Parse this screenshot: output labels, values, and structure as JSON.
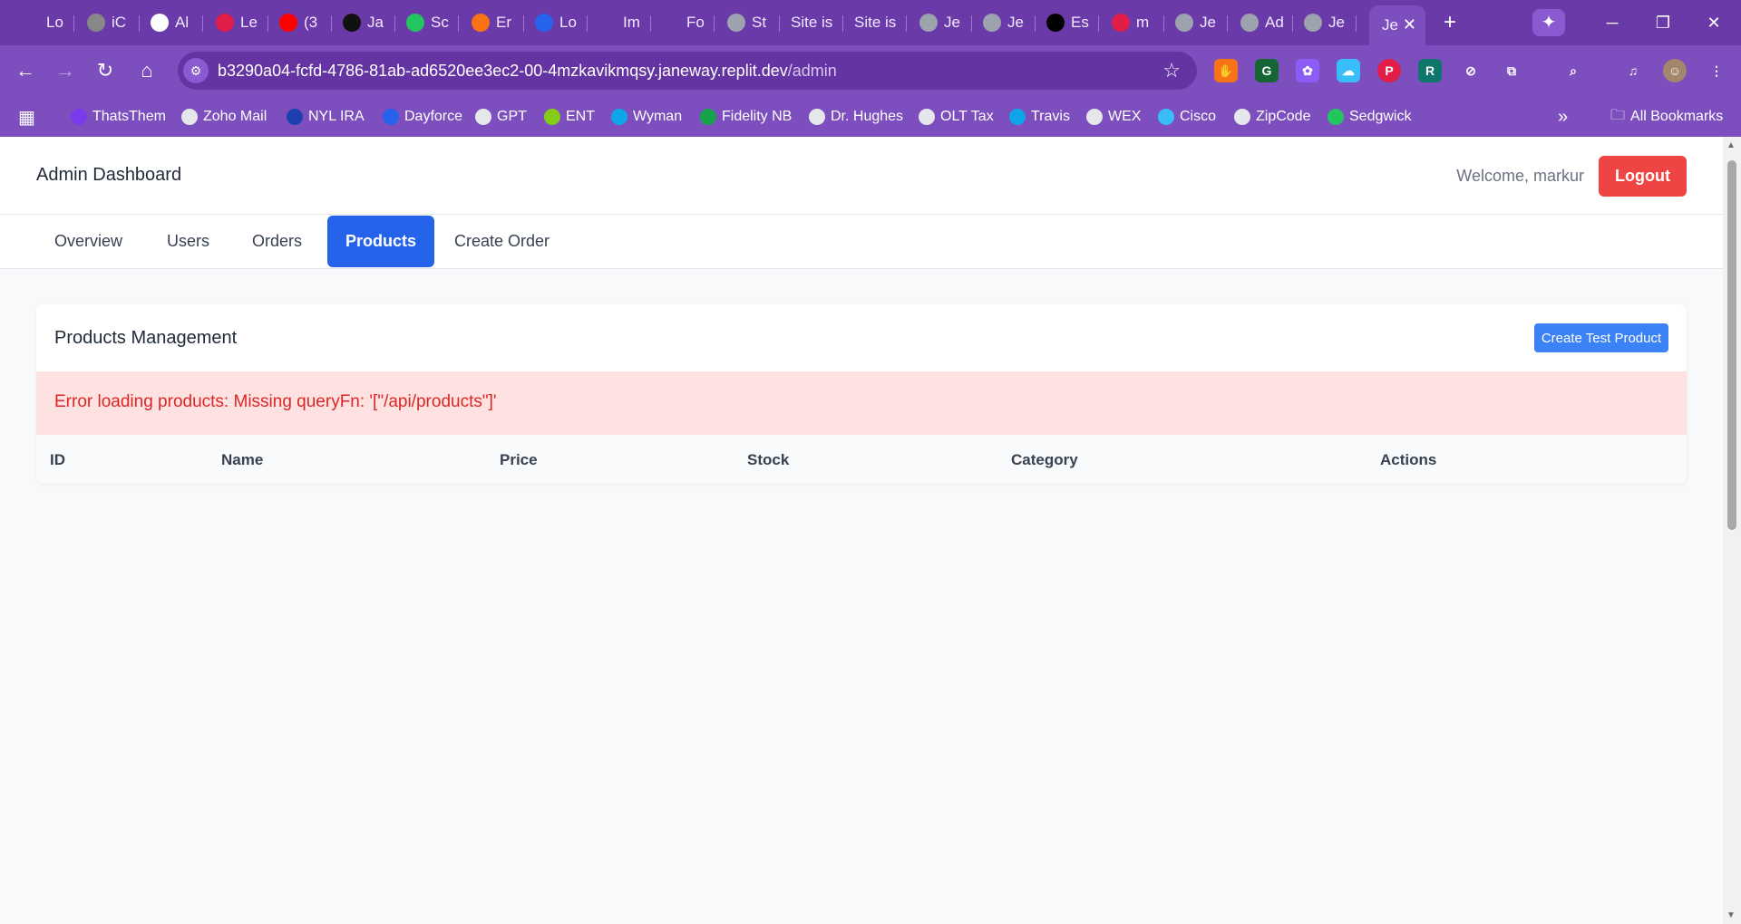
{
  "browser": {
    "tabs": [
      {
        "title": "Lo",
        "icon": "loading-icon",
        "color": "#6a3aa8"
      },
      {
        "title": "iC",
        "icon": "apple-icon",
        "color": "#888888"
      },
      {
        "title": "Al",
        "icon": "ai-icon",
        "color": "#ffffff"
      },
      {
        "title": "Le",
        "icon": "m-logo-icon",
        "color": "#e11d48"
      },
      {
        "title": "(3",
        "icon": "youtube-icon",
        "color": "#ff0000"
      },
      {
        "title": "Ja",
        "icon": "pen-icon",
        "color": "#111111"
      },
      {
        "title": "Sc",
        "icon": "power-icon",
        "color": "#22c55e"
      },
      {
        "title": "Er",
        "icon": "star-badge-icon",
        "color": "#f97316"
      },
      {
        "title": "Lo",
        "icon": "network-icon",
        "color": "#2563eb"
      },
      {
        "title": "Im",
        "icon": "dot-icon",
        "color": "#6a3aa8"
      },
      {
        "title": "Fo",
        "icon": "loading-icon",
        "color": "#6a3aa8"
      },
      {
        "title": "St",
        "icon": "globe-icon",
        "color": "#9ca3af"
      },
      {
        "title": "Site is",
        "icon": "",
        "color": ""
      },
      {
        "title": "Site is",
        "icon": "",
        "color": ""
      },
      {
        "title": "Je",
        "icon": "globe-icon",
        "color": "#9ca3af"
      },
      {
        "title": "Je",
        "icon": "globe-icon",
        "color": "#9ca3af"
      },
      {
        "title": "Es",
        "icon": "mc-icon",
        "color": "#000000"
      },
      {
        "title": "m",
        "icon": "m-logo-icon",
        "color": "#e11d48"
      },
      {
        "title": "Je",
        "icon": "globe-icon",
        "color": "#9ca3af"
      },
      {
        "title": "Ad",
        "icon": "globe-icon",
        "color": "#9ca3af"
      },
      {
        "title": "Je",
        "icon": "globe-icon",
        "color": "#9ca3af"
      }
    ],
    "active_tab": {
      "title": "Je",
      "close_glyph": "✕"
    },
    "new_tab_glyph": "+",
    "url": {
      "host": "b3290a04-fcfd-4786-81ab-ad6520ee3ec2-00-4mzkavikmqsy.janeway.replit.dev",
      "path": "/admin"
    },
    "bookmarks": [
      {
        "label": "ThatsThem",
        "icon": "t-icon",
        "color": "#7c3aed"
      },
      {
        "label": "Zoho Mail",
        "icon": "mail-icon",
        "color": "#e5e7eb"
      },
      {
        "label": "NYL IRA",
        "icon": "nyl-icon",
        "color": "#1e40af"
      },
      {
        "label": "Dayforce",
        "icon": "dayforce-icon",
        "color": "#2563eb"
      },
      {
        "label": "GPT",
        "icon": "openai-icon",
        "color": "#e5e7eb"
      },
      {
        "label": "ENT",
        "icon": "leaf-icon",
        "color": "#84cc16"
      },
      {
        "label": "Wyman",
        "icon": "wyman-icon",
        "color": "#0ea5e9"
      },
      {
        "label": "Fidelity NB",
        "icon": "fidelity-icon",
        "color": "#16a34a"
      },
      {
        "label": "Dr. Hughes",
        "icon": "doc-icon",
        "color": "#e5e7eb"
      },
      {
        "label": "OLT Tax",
        "icon": "olt-icon",
        "color": "#e5e7eb"
      },
      {
        "label": "Travis",
        "icon": "star-icon",
        "color": "#0ea5e9"
      },
      {
        "label": "WEX",
        "icon": "globe-icon",
        "color": "#e5e7eb"
      },
      {
        "label": "Cisco",
        "icon": "cisco-icon",
        "color": "#38bdf8"
      },
      {
        "label": "ZipCode",
        "icon": "globe-icon",
        "color": "#e5e7eb"
      },
      {
        "label": "Sedgwick",
        "icon": "sedgwick-icon",
        "color": "#22c55e"
      }
    ],
    "all_bookmarks_label": "All Bookmarks"
  },
  "app": {
    "title": "Admin Dashboard",
    "welcome": "Welcome, markur",
    "logout_label": "Logout",
    "tabs": [
      "Overview",
      "Users",
      "Orders",
      "Products",
      "Create Order"
    ],
    "active_tab": "Products",
    "accent_color": "#2563eb",
    "danger_color": "#ef4444"
  },
  "products": {
    "title": "Products Management",
    "create_button_label": "Create Test Product",
    "error_message": "Error loading products: Missing queryFn: '[\"/api/products\"]'",
    "columns": [
      "ID",
      "Name",
      "Price",
      "Stock",
      "Category",
      "Actions"
    ]
  }
}
